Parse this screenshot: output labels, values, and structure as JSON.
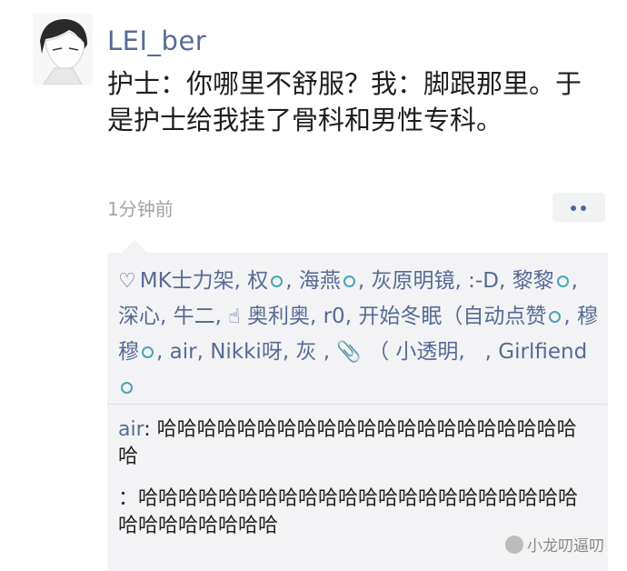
{
  "post": {
    "username": "LEI_ber",
    "text": "护士：你哪里不舒服？我：脚跟那里。于是护士给我挂了骨科和男性专科。",
    "timestamp": "1分钟前"
  },
  "likes": {
    "names": [
      "MK士力架",
      "权",
      "海燕",
      "灰原明镜",
      ":-D",
      "黎黎",
      "深心",
      "牛二",
      "奥利奥",
      "r0",
      "开始冬眠（自动点赞",
      "穆穆",
      "air",
      "Nikki呀",
      "灰",
      "（ 小透明",
      "Girlfiend"
    ]
  },
  "comments": [
    {
      "author": "air",
      "text": "哈哈哈哈哈哈哈哈哈哈哈哈哈哈哈哈哈哈哈哈哈哈"
    },
    {
      "author": "",
      "text": "：哈哈哈哈哈哈哈哈哈哈哈哈哈哈哈哈哈哈哈哈哈哈哈哈哈哈哈哈哈哈"
    }
  ],
  "watermark": {
    "text": "小龙叨逼叨"
  },
  "icons": {
    "heart": "heart-icon",
    "more": "more-dots-icon",
    "hand": "pointing-hand-icon",
    "clip": "paperclip-icon"
  },
  "colors": {
    "link": "#576b95",
    "panel": "#f3f3f5",
    "ring": "#4aa4b8"
  }
}
